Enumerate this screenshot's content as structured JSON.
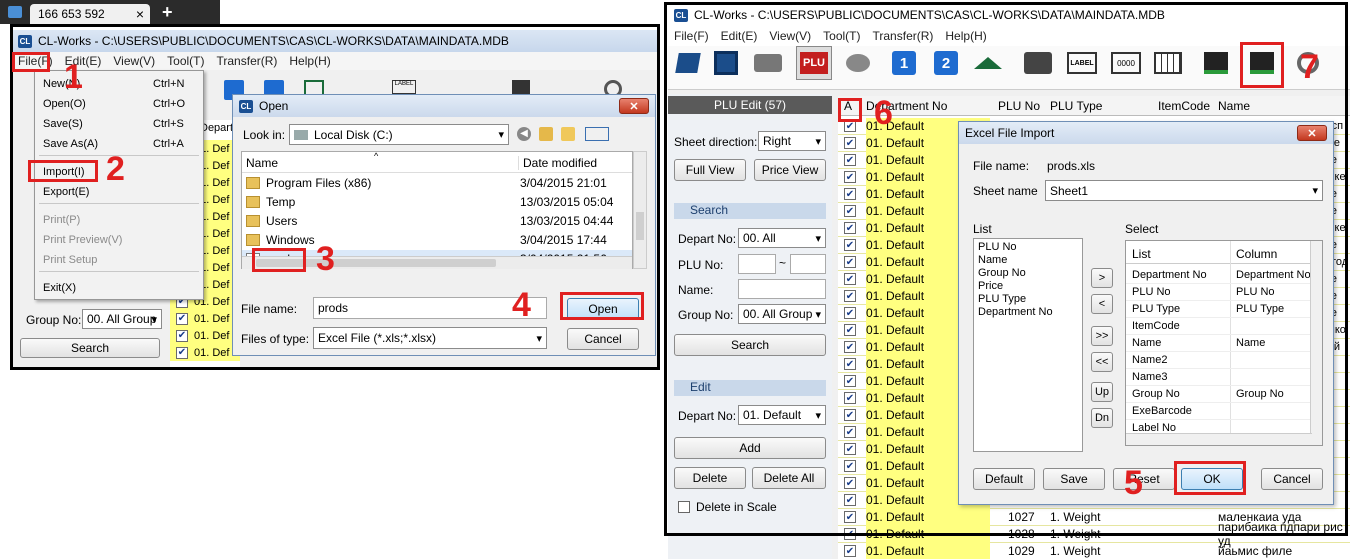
{
  "browser_tab": {
    "label": "166 653 592",
    "close": "×",
    "new_tab": "+"
  },
  "left_window": {
    "title": "CL-Works - C:\\USERS\\PUBLIC\\DOCUMENTS\\CAS\\CL-WORKS\\DATA\\MAINDATA.MDB",
    "menu": [
      "File(F)",
      "Edit(E)",
      "View(V)",
      "Tool(T)",
      "Transfer(R)",
      "Help(H)"
    ],
    "file_menu": [
      {
        "label": "New(N)",
        "shortcut": "Ctrl+N",
        "enabled": true
      },
      {
        "label": "Open(O)",
        "shortcut": "Ctrl+O",
        "enabled": true
      },
      {
        "label": "Save(S)",
        "shortcut": "Ctrl+S",
        "enabled": true
      },
      {
        "label": "Save As(A)",
        "shortcut": "Ctrl+A",
        "enabled": true
      },
      {
        "label": "Import(I)",
        "shortcut": "",
        "enabled": true
      },
      {
        "label": "Export(E)",
        "shortcut": "",
        "enabled": true
      },
      {
        "label": "Print(P)",
        "shortcut": "",
        "enabled": false
      },
      {
        "label": "Print Preview(V)",
        "shortcut": "",
        "enabled": false
      },
      {
        "label": "Print Setup",
        "shortcut": "",
        "enabled": false
      },
      {
        "label": "Exit(X)",
        "shortcut": "",
        "enabled": true
      }
    ],
    "col_header": "Departm",
    "row_text": "01. Def",
    "group_label": "Group No:",
    "group_value": "00. All Group",
    "search_button": "Search"
  },
  "open_dialog": {
    "title": "Open",
    "look_in_label": "Look in:",
    "look_in_value": "Local Disk (C:)",
    "col_name": "Name",
    "col_date": "Date modified",
    "files": [
      {
        "name": "Program Files (x86)",
        "date": "3/04/2015 21:01",
        "type": "folder"
      },
      {
        "name": "Temp",
        "date": "13/03/2015 05:04",
        "type": "folder"
      },
      {
        "name": "Users",
        "date": "13/03/2015 04:44",
        "type": "folder"
      },
      {
        "name": "Windows",
        "date": "3/04/2015 17:44",
        "type": "folder"
      },
      {
        "name": "prods",
        "date": "3/04/2015 21:56",
        "type": "file"
      }
    ],
    "file_name_label": "File name:",
    "file_name_value": "prods",
    "file_type_label": "Files of type:",
    "file_type_value": "Excel File (*.xls;*.xlsx)",
    "open_button": "Open",
    "cancel_button": "Cancel"
  },
  "right_window": {
    "title": "CL-Works - C:\\USERS\\PUBLIC\\DOCUMENTS\\CAS\\CL-WORKS\\DATA\\MAINDATA.MDB",
    "menu": [
      "File(F)",
      "Edit(E)",
      "View(V)",
      "Tool(T)",
      "Transfer(R)",
      "Help(H)"
    ],
    "toolbar": [
      "open-icon",
      "save-icon",
      "print-icon",
      "plu-icon",
      "coins-icon",
      "number-1-icon",
      "number-2-icon",
      "home-icon",
      "scale-icon",
      "label-icon",
      "barcode-icon",
      "grid-icon",
      "send-icon",
      "receive-icon",
      "settings-icon"
    ],
    "toolbar_text": {
      "plu": "PLU",
      "one": "1",
      "two": "2",
      "label": "LABEL",
      "barcode": "0000"
    },
    "panel": {
      "header": "PLU Edit (57)",
      "sheet_direction_label": "Sheet direction:",
      "sheet_direction_value": "Right",
      "full_view": "Full View",
      "price_view": "Price View",
      "search_section": "Search",
      "depart_label": "Depart No:",
      "depart_value": "00. All",
      "plu_label": "PLU No:",
      "tilde": "~",
      "name_label": "Name:",
      "group_label": "Group No:",
      "group_value": "00. All Group",
      "search_button": "Search",
      "edit_section": "Edit",
      "edit_depart_label": "Depart No:",
      "edit_depart_value": "01. Default",
      "add_button": "Add",
      "delete_button": "Delete",
      "delete_all_button": "Delete All",
      "delete_in_scale": "Delete in Scale"
    },
    "grid": {
      "columns": [
        "A",
        "Department No",
        "PLU No",
        "PLU Type",
        "ItemCode",
        "Name"
      ],
      "row_dept": "01. Default",
      "visible_rows": [
        {
          "plu": "1027",
          "type": "1. Weight",
          "name": "маленкаиа уда"
        },
        {
          "plu": "1028",
          "type": "1. Weight",
          "name": "парибаика пдпари рис уд"
        },
        {
          "plu": "1029",
          "type": "1. Weight",
          "name": "йаьмис филе"
        }
      ],
      "name_fragments": [
        "эсп",
        "ые",
        "ке",
        "с ке",
        "ке",
        "ке",
        "с ке",
        "ке",
        "егод",
        "ке",
        "ке",
        "ке",
        "шко",
        "ый"
      ]
    }
  },
  "excel_dialog": {
    "title": "Excel File Import",
    "file_name_label": "File name:",
    "file_name_value": "prods.xls",
    "sheet_label": "Sheet name",
    "sheet_value": "Sheet1",
    "list_label": "List",
    "list_items": [
      "PLU No",
      "Name",
      "Group No",
      "Price",
      "PLU Type",
      "Department No"
    ],
    "select_label": "Select",
    "select_col_list": "List",
    "select_col_column": "Column",
    "select_rows": [
      {
        "list": "Department No",
        "column": "Department No"
      },
      {
        "list": "PLU No",
        "column": "PLU No"
      },
      {
        "list": "PLU Type",
        "column": "PLU Type"
      },
      {
        "list": "ItemCode",
        "column": ""
      },
      {
        "list": "Name",
        "column": "Name"
      },
      {
        "list": "Name2",
        "column": ""
      },
      {
        "list": "Name3",
        "column": ""
      },
      {
        "list": "Group No",
        "column": "Group No"
      },
      {
        "list": "ExeBarcode",
        "column": ""
      },
      {
        "list": "Label No",
        "column": ""
      }
    ],
    "move_buttons": [
      ">",
      "<",
      ">>",
      "<<",
      "Up",
      "Dn"
    ],
    "default_button": "Default",
    "save_button": "Save",
    "reset_button": "Reset",
    "ok_button": "OK",
    "cancel_button": "Cancel"
  },
  "step_numbers": [
    "1",
    "2",
    "3",
    "4",
    "5",
    "6",
    "7"
  ],
  "colors": {
    "highlight": "#e02020",
    "row_yellow": "#ffff80",
    "accent": "#1a4f93"
  }
}
